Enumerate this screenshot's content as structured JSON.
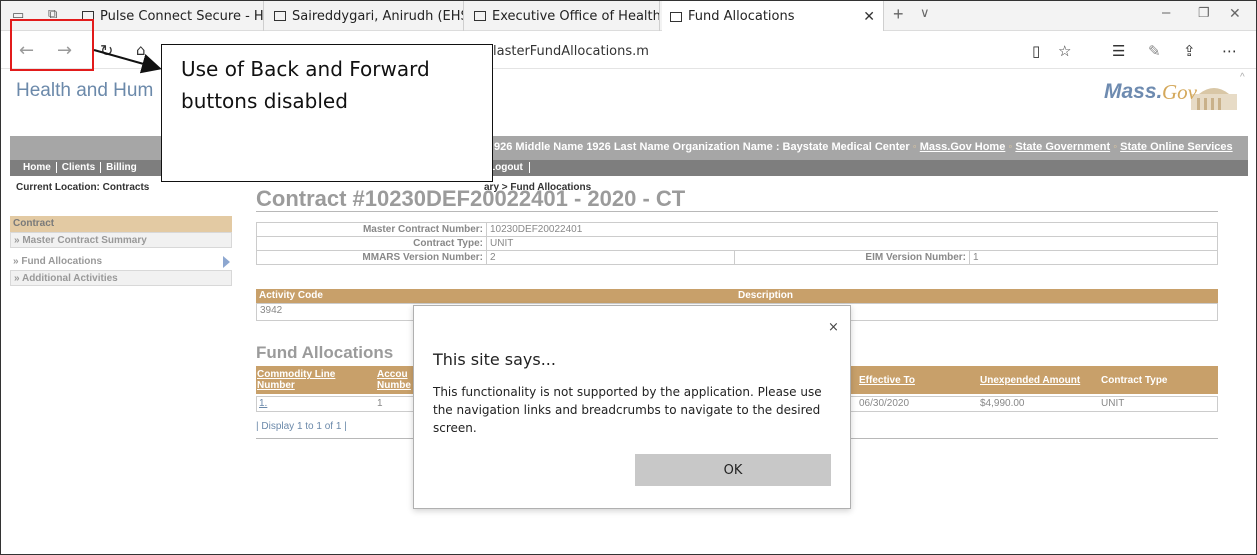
{
  "browser": {
    "tabs": [
      {
        "label": "Pulse Connect Secure - Hom"
      },
      {
        "label": "Saireddygari, Anirudh (EHS)"
      },
      {
        "label": "Executive Office of Health a"
      },
      {
        "label": "Fund Allocations"
      }
    ],
    "url": "lasterFundAllocations.m",
    "icons": [
      "back-icon",
      "forward-icon",
      "refresh-icon",
      "home-icon",
      "reading-view-icon",
      "favorite-star-icon",
      "favorites-hub-icon",
      "pen-icon",
      "share-icon",
      "more-icon"
    ]
  },
  "page": {
    "site_title": "Health and Hum",
    "logo_mass": "Mass.",
    "logo_gov": "Gov",
    "user_info": "926 Middle Name 1926 Last Name Organization Name : Baystate Medical Center",
    "top_links": [
      "Mass.Gov Home",
      "State Government",
      "State Online Services"
    ],
    "nav_links": [
      "Home",
      "Clients",
      "Billing"
    ],
    "logout": "Logout",
    "breadcrumb_prefix": "Current Location: Contracts",
    "breadcrumb_suffix": "ary > Fund Allocations",
    "sidebar": {
      "header": "Contract",
      "items": [
        "» Master Contract Summary",
        "» Fund Allocations",
        "» Additional Activities"
      ]
    },
    "contract_title": "Contract #10230DEF20022401 - 2020 - CT",
    "info": {
      "master_contract_label": "Master Contract Number:",
      "master_contract_value": "10230DEF20022401",
      "contract_type_label": "Contract Type:",
      "contract_type_value": "UNIT",
      "mmars_label": "MMARS Version Number:",
      "mmars_value": "2",
      "eim_label": "EIM Version Number:",
      "eim_value": "1"
    },
    "activity": {
      "code_header": "Activity Code",
      "desc_header": "Description",
      "code_value": "3942"
    },
    "fund": {
      "title": "Fund Allocations",
      "headers": {
        "commodity_line_1": "Commodity Line",
        "commodity_line_2": "Number",
        "account_1": "Accou",
        "account_2": "Numbe",
        "effective_to": "Effective To",
        "unexpended": "Unexpended Amount",
        "contract_type": "Contract Type"
      },
      "row": {
        "commodity": "1.",
        "account": "1",
        "effective_to": "06/30/2020",
        "unexpended": "$4,990.00",
        "contract_type": "UNIT"
      },
      "display": "| Display 1 to 1 of 1 |"
    }
  },
  "dialog": {
    "close": "×",
    "title": "This site says...",
    "message": "This functionality is not supported by the application. Please use the navigation links and breadcrumbs to navigate to the desired screen.",
    "ok": "OK"
  },
  "annotation": {
    "callout": "Use of Back and Forward buttons disabled",
    "highlight_color": "#e21b1b"
  }
}
